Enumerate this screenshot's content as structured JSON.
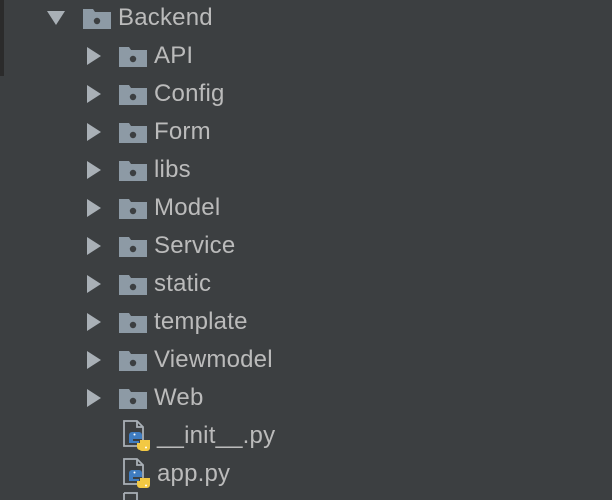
{
  "tree": {
    "root": {
      "label": "Backend",
      "expanded": true,
      "icon": "folder-icon"
    },
    "folders": [
      {
        "label": "API",
        "icon": "folder-icon"
      },
      {
        "label": "Config",
        "icon": "folder-icon"
      },
      {
        "label": "Form",
        "icon": "folder-icon"
      },
      {
        "label": "libs",
        "icon": "folder-icon"
      },
      {
        "label": "Model",
        "icon": "folder-icon"
      },
      {
        "label": "Service",
        "icon": "folder-icon"
      },
      {
        "label": "static",
        "icon": "folder-icon"
      },
      {
        "label": "template",
        "icon": "folder-icon"
      },
      {
        "label": "Viewmodel",
        "icon": "folder-icon"
      },
      {
        "label": "Web",
        "icon": "folder-icon"
      }
    ],
    "files": [
      {
        "label": "__init__.py",
        "icon": "python-file-icon"
      },
      {
        "label": "app.py",
        "icon": "python-file-icon"
      }
    ]
  },
  "colors": {
    "background": "#3c3f41",
    "text": "#bbbbbb",
    "folder": "#8d9aa5",
    "arrow": "#a9b0b6",
    "python_blue": "#3f7cc0",
    "python_yellow": "#f2c843"
  }
}
